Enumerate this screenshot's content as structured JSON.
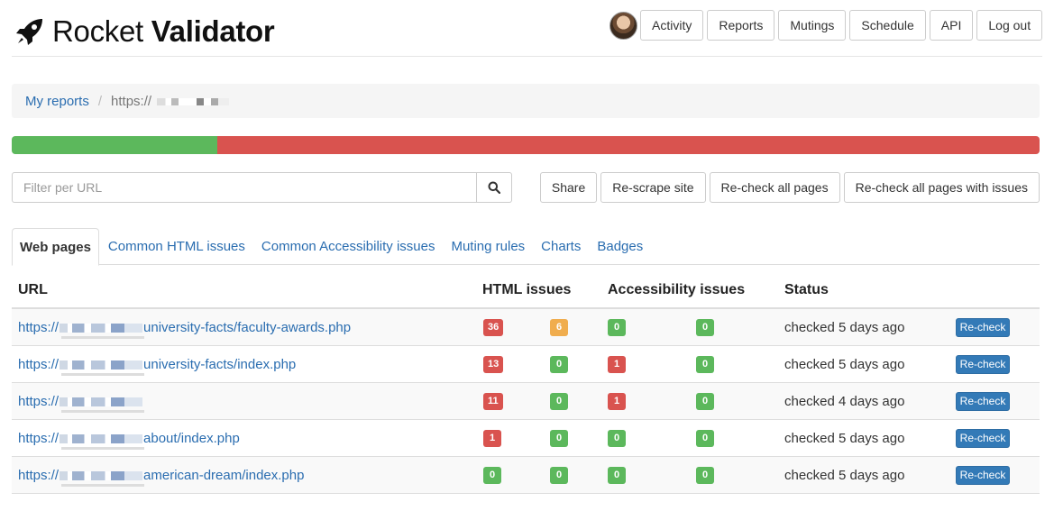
{
  "app": {
    "name_light": "Rocket",
    "name_bold": "Validator"
  },
  "nav": [
    "Activity",
    "Reports",
    "Mutings",
    "Schedule",
    "API",
    "Log out"
  ],
  "breadcrumb": {
    "root": "My reports",
    "current": "https://"
  },
  "progress": {
    "ok_percent": 20
  },
  "filter": {
    "placeholder": "Filter per URL"
  },
  "actions": [
    "Share",
    "Re-scrape site",
    "Re-check all pages",
    "Re-check all pages with issues"
  ],
  "tabs": [
    "Web pages",
    "Common HTML issues",
    "Common Accessibility issues",
    "Muting rules",
    "Charts",
    "Badges"
  ],
  "table": {
    "headers": {
      "url": "URL",
      "html": "HTML issues",
      "accessibility": "Accessibility issues",
      "status": "Status"
    },
    "recheck_label": "Re-check",
    "rows": [
      {
        "url_prefix": "https://",
        "url_path": "university-facts/faculty-awards.php",
        "html_errors": "36",
        "html_warnings": "6",
        "a11y_errors": "0",
        "a11y_warnings": "0",
        "status": "checked 5 days ago"
      },
      {
        "url_prefix": "https://",
        "url_path": "university-facts/index.php",
        "html_errors": "13",
        "html_warnings": "0",
        "a11y_errors": "1",
        "a11y_warnings": "0",
        "status": "checked 5 days ago"
      },
      {
        "url_prefix": "https://",
        "url_path": "",
        "html_errors": "11",
        "html_warnings": "0",
        "a11y_errors": "1",
        "a11y_warnings": "0",
        "status": "checked 4 days ago"
      },
      {
        "url_prefix": "https://",
        "url_path": "about/index.php",
        "html_errors": "1",
        "html_warnings": "0",
        "a11y_errors": "0",
        "a11y_warnings": "0",
        "status": "checked 5 days ago"
      },
      {
        "url_prefix": "https://",
        "url_path": "american-dream/index.php",
        "html_errors": "0",
        "html_warnings": "0",
        "a11y_errors": "0",
        "a11y_warnings": "0",
        "status": "checked 5 days ago"
      }
    ]
  },
  "colors": {
    "link": "#2a6db0",
    "success": "#5cb85c",
    "danger": "#d9534f",
    "warning": "#f0ad4e",
    "primary": "#337ab7"
  },
  "icons": {
    "logo": "rocket-icon",
    "search": "search-icon"
  }
}
